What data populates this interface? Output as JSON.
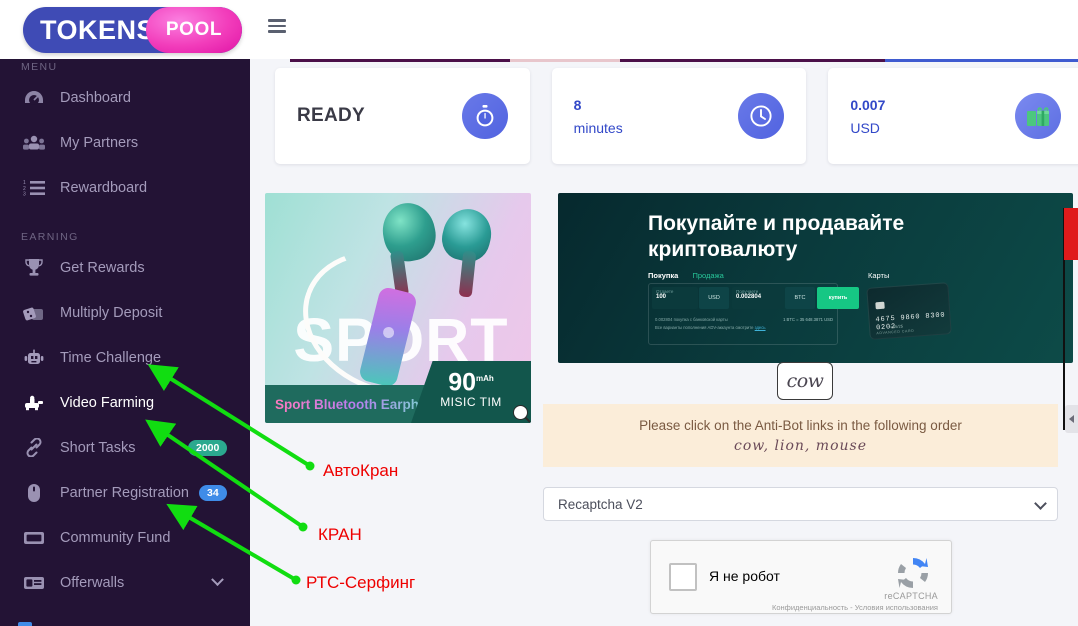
{
  "brand": {
    "name_main": "TOKENS",
    "name_accent": "POOL"
  },
  "topbar": {
    "menu_toggle": "hamburger-menu"
  },
  "sidebar": {
    "section_menu": "MENU",
    "section_earning": "EARNING",
    "items": [
      {
        "label": "Dashboard",
        "icon": "dashboard-gauge-icon",
        "badge": ""
      },
      {
        "label": "My Partners",
        "icon": "users-group-icon",
        "badge": ""
      },
      {
        "label": "Rewardboard",
        "icon": "ordered-list-icon",
        "badge": ""
      }
    ],
    "earning_items": [
      {
        "label": "Get Rewards",
        "icon": "trophy-icon",
        "badge": ""
      },
      {
        "label": "Multiply Deposit",
        "icon": "dice-icon",
        "badge": ""
      },
      {
        "label": "Time Challenge",
        "icon": "robot-icon",
        "badge": ""
      },
      {
        "label": "Video Farming",
        "icon": "faucet-icon",
        "badge": ""
      },
      {
        "label": "Short Tasks",
        "icon": "link-chain-icon",
        "badge": "2000"
      },
      {
        "label": "Partner Registration",
        "icon": "mouse-icon",
        "badge": "34"
      },
      {
        "label": "Community Fund",
        "icon": "ticket-icon",
        "badge": ""
      },
      {
        "label": "Offerwalls",
        "icon": "id-card-icon",
        "badge": ""
      }
    ]
  },
  "stats": [
    {
      "name": "status",
      "big": "READY",
      "num": "",
      "sub": "",
      "icon": "stopwatch-icon"
    },
    {
      "name": "timer",
      "big": "",
      "num": "8",
      "sub": "minutes",
      "icon": "clock-icon"
    },
    {
      "name": "balance",
      "big": "",
      "num": "0.007",
      "sub": "USD",
      "icon": "gift-icon"
    }
  ],
  "ad_sport": {
    "headline": "SPORT",
    "footer": "Sport Bluetooth Earphone",
    "badge_number": "90",
    "badge_unit": "mAh",
    "badge_text": "MISIC TIM"
  },
  "ad_crypto": {
    "headline": "Покупайте и продавайте криптовалюту",
    "tab_buy": "Покупка",
    "tab_sell": "Продажа",
    "field_give_label": "Отдаете",
    "field_give_value": "100",
    "currency_from": "USD",
    "field_get_label": "Получаете",
    "field_get_value": "0.002804",
    "currency_to": "BTC",
    "button": "купить",
    "note_left": "0.002804 покупка с банковской карты",
    "note_rate": "1 BTC = 35 648.3871 USD",
    "note_second": "Все варианты пополнения ADV-аккаунта смотрите",
    "note_link": "здесь",
    "cards_label": "Карты",
    "card_number": "4675 9860 8300 0202",
    "card_expiry": "•• 05/25",
    "card_brand": "ADVANCED CARD",
    "card2_number": "0202",
    "card2_brand": "ADVANCED CARD"
  },
  "captcha": {
    "image_word": "cow",
    "instruction": "Please click on the Anti-Bot links in the following order",
    "order": "cow, lion, mouse"
  },
  "captcha_select": {
    "value": "Recaptcha V2"
  },
  "recaptcha": {
    "label": "Я не робот",
    "brand": "reCAPTCHA",
    "terms": "Конфиденциальность - Условия использования"
  },
  "annotations": [
    {
      "text": "АвтоКран"
    },
    {
      "text": "КРАН"
    },
    {
      "text": "РТС-Серфинг"
    }
  ],
  "colors": {
    "sidebar_bg": "#231335",
    "logo_blue": "#3f4bb5",
    "logo_pink": "#f23dbb",
    "accent_blue": "#3248c8",
    "badge_teal": "#2ba98f",
    "badge_blue": "#3f8ce8",
    "annotation_red": "#ee0000",
    "arrow_green": "#11dd11",
    "antibot_bg": "#fbedd9"
  }
}
